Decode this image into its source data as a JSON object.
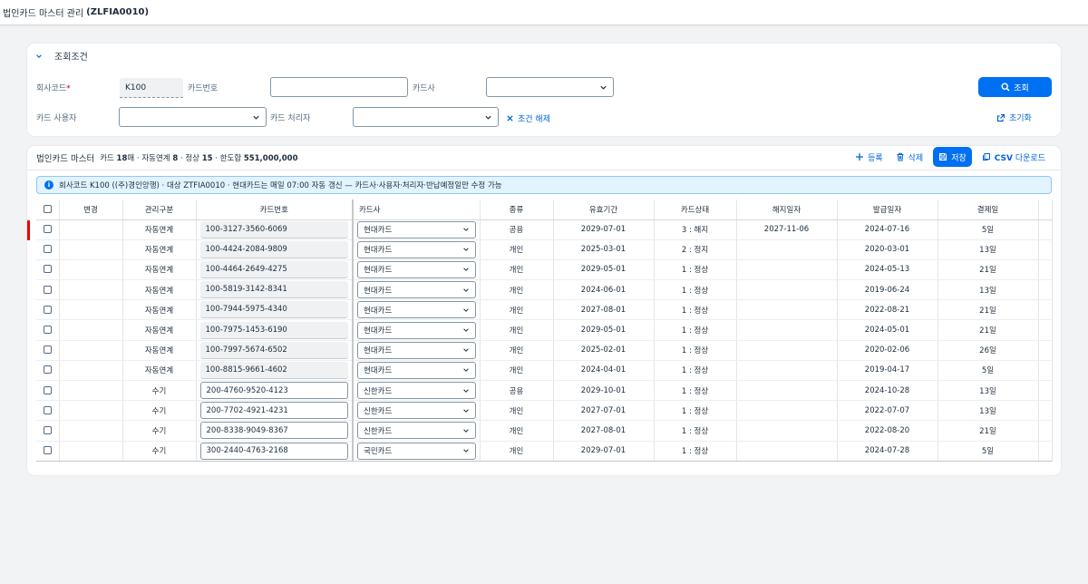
{
  "shell": {
    "title": "법인카드 마스터 관리",
    "code": "(ZLFIA0010)"
  },
  "filter": {
    "header": "조회조건",
    "company_label": "회사코드",
    "company_required": "*",
    "company_value": "K100",
    "card_no_label": "카드번호",
    "card_no_value": "",
    "card_co_label": "카드사",
    "card_co_value": "",
    "user_label": "카드 사용자",
    "user_value": "",
    "handler_label": "카드 처리자",
    "handler_value": "",
    "clear_label": "조건 해제",
    "search_label": "조회",
    "reset_label": "초기화"
  },
  "table": {
    "title": "법인카드 마스터",
    "stats": {
      "cards_prefix": "카드 ",
      "cards_count": "18",
      "cards_suffix": "매 · 자동연계 ",
      "auto_count": "8",
      "normal_prefix": " · 정상 ",
      "normal_count": "15",
      "limit_prefix": " · 한도합 ",
      "limit_total": "551,000,000"
    },
    "tools": {
      "add": "등록",
      "delete": "삭제",
      "save": "저장",
      "csv_bold": "CSV",
      "csv_rest": " 다운로드"
    },
    "info": "회사코드 K100 ((주)경인앙행) · 대상 ZTFIA0010 · 현대카드는 매일 07:00 자동 갱신 — 카드사·사용자·처리자·반납예정일만 수정 가능",
    "columns": [
      "변경",
      "관리구분",
      "카드번호",
      "카드사",
      "종류",
      "유효기간",
      "카드상태",
      "해지일자",
      "발급일자",
      "결제일"
    ],
    "rows": [
      {
        "mgmt": "자동연계",
        "auto": true,
        "card": "100-3127-3560-6069",
        "company": "현대카드",
        "kind": "공용",
        "valid": "2029-07-01",
        "status": "3 : 해지",
        "st": "cancel",
        "term": "2027-11-06",
        "issued": "2024-07-16",
        "pay": "5일",
        "marked": true
      },
      {
        "mgmt": "자동연계",
        "auto": true,
        "card": "100-4424-2084-9809",
        "company": "현대카드",
        "kind": "개인",
        "valid": "2025-03-01",
        "status": "2 : 정지",
        "st": "cancel",
        "term": "",
        "issued": "2020-03-01",
        "pay": "13일"
      },
      {
        "mgmt": "자동연계",
        "auto": true,
        "card": "100-4464-2649-4275",
        "company": "현대카드",
        "kind": "개인",
        "valid": "2029-05-01",
        "status": "1 : 정상",
        "st": "normal",
        "term": "",
        "issued": "2024-05-13",
        "pay": "21일"
      },
      {
        "mgmt": "자동연계",
        "auto": true,
        "card": "100-5819-3142-8341",
        "company": "현대카드",
        "kind": "개인",
        "valid": "2024-06-01",
        "status": "1 : 정상",
        "st": "normal",
        "term": "",
        "issued": "2019-06-24",
        "pay": "13일"
      },
      {
        "mgmt": "자동연계",
        "auto": true,
        "card": "100-7944-5975-4340",
        "company": "현대카드",
        "kind": "개인",
        "valid": "2027-08-01",
        "status": "1 : 정상",
        "st": "normal",
        "term": "",
        "issued": "2022-08-21",
        "pay": "21일"
      },
      {
        "mgmt": "자동연계",
        "auto": true,
        "card": "100-7975-1453-6190",
        "company": "현대카드",
        "kind": "개인",
        "valid": "2029-05-01",
        "status": "1 : 정상",
        "st": "normal",
        "term": "",
        "issued": "2024-05-01",
        "pay": "21일"
      },
      {
        "mgmt": "자동연계",
        "auto": true,
        "card": "100-7997-5674-6502",
        "company": "현대카드",
        "kind": "개인",
        "valid": "2025-02-01",
        "status": "1 : 정상",
        "st": "normal",
        "term": "",
        "issued": "2020-02-06",
        "pay": "26일"
      },
      {
        "mgmt": "자동연계",
        "auto": true,
        "card": "100-8815-9661-4602",
        "company": "현대카드",
        "kind": "개인",
        "valid": "2024-04-01",
        "status": "1 : 정상",
        "st": "normal",
        "term": "",
        "issued": "2019-04-17",
        "pay": "5일"
      },
      {
        "mgmt": "수기",
        "auto": false,
        "card": "200-4760-9520-4123",
        "company": "신한카드",
        "kind": "공용",
        "valid": "2029-10-01",
        "status": "1 : 정상",
        "st": "normal",
        "term": "",
        "issued": "2024-10-28",
        "pay": "13일"
      },
      {
        "mgmt": "수기",
        "auto": false,
        "card": "200-7702-4921-4231",
        "company": "신한카드",
        "kind": "개인",
        "valid": "2027-07-01",
        "status": "1 : 정상",
        "st": "normal",
        "term": "",
        "issued": "2022-07-07",
        "pay": "13일"
      },
      {
        "mgmt": "수기",
        "auto": false,
        "card": "200-8338-9049-8367",
        "company": "신한카드",
        "kind": "개인",
        "valid": "2027-08-01",
        "status": "1 : 정상",
        "st": "normal",
        "term": "",
        "issued": "2022-08-20",
        "pay": "21일"
      },
      {
        "mgmt": "수기",
        "auto": false,
        "card": "300-2440-4763-2168",
        "company": "국민카드",
        "kind": "개인",
        "valid": "2029-07-01",
        "status": "1 : 정상",
        "st": "normal",
        "term": "",
        "issued": "2024-07-28",
        "pay": "5일"
      }
    ]
  }
}
